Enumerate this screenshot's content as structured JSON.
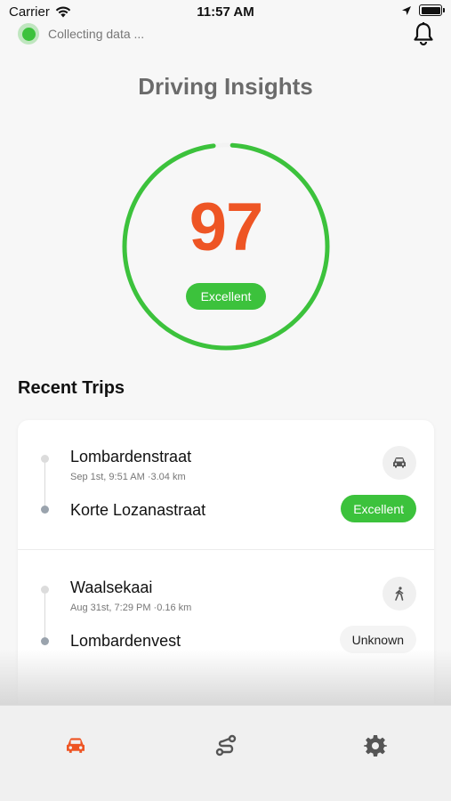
{
  "status_bar": {
    "carrier": "Carrier",
    "time": "11:57 AM"
  },
  "header": {
    "collecting_text": "Collecting data ...",
    "title": "Driving Insights"
  },
  "score": {
    "value": "97",
    "label": "Excellent",
    "ring_fraction": 0.97
  },
  "recent_trips": {
    "title": "Recent Trips",
    "trips": [
      {
        "from": "Lombardenstraat",
        "meta": "Sep 1st, 9:51 AM ·3.04 km",
        "to": "Korte Lozanastraat",
        "mode_icon": "car-icon",
        "rating": "Excellent"
      },
      {
        "from": "Waalsekaai",
        "meta": "Aug 31st, 7:29 PM ·0.16 km",
        "to": "Lombardenvest",
        "mode_icon": "walking-icon",
        "rating": "Unknown"
      }
    ]
  },
  "tab_bar": {
    "tabs": [
      {
        "icon": "car-icon",
        "active": true
      },
      {
        "icon": "route-icon",
        "active": false
      },
      {
        "icon": "gear-icon",
        "active": false
      }
    ]
  },
  "colors": {
    "accent": "#ee5524",
    "success": "#3cc23c",
    "muted": "#6b6b6b"
  }
}
